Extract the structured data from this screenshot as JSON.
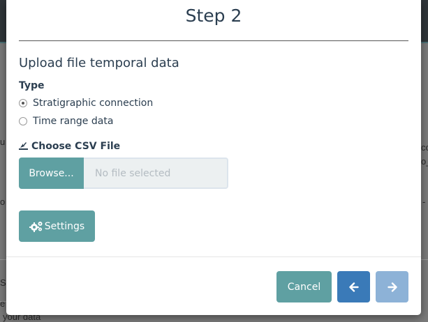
{
  "modal": {
    "title": "Step 2",
    "section_title": "Upload file temporal data",
    "type_label": "Type",
    "radio_options": [
      {
        "label": "Stratigraphic connection",
        "checked": true
      },
      {
        "label": "Time range data",
        "checked": false
      }
    ],
    "file_input": {
      "label": "Choose CSV File",
      "browse_label": "Browse...",
      "placeholder": "No file selected"
    },
    "settings_label": "Settings",
    "footer": {
      "cancel_label": "Cancel"
    }
  },
  "colors": {
    "primary_teal": "#5fa0a2",
    "nav_blue": "#3a7ab8",
    "nav_blue_disabled": "#8db2d7",
    "text": "#2b3e50"
  },
  "icons": {
    "upload": "upload-icon",
    "settings": "gears-icon",
    "prev": "arrow-left-icon",
    "next": "arrow-right-icon"
  },
  "background_fragments": [
    "u",
    "co",
    "o_",
    "o",
    "-",
    "S",
    "e",
    "your data"
  ]
}
